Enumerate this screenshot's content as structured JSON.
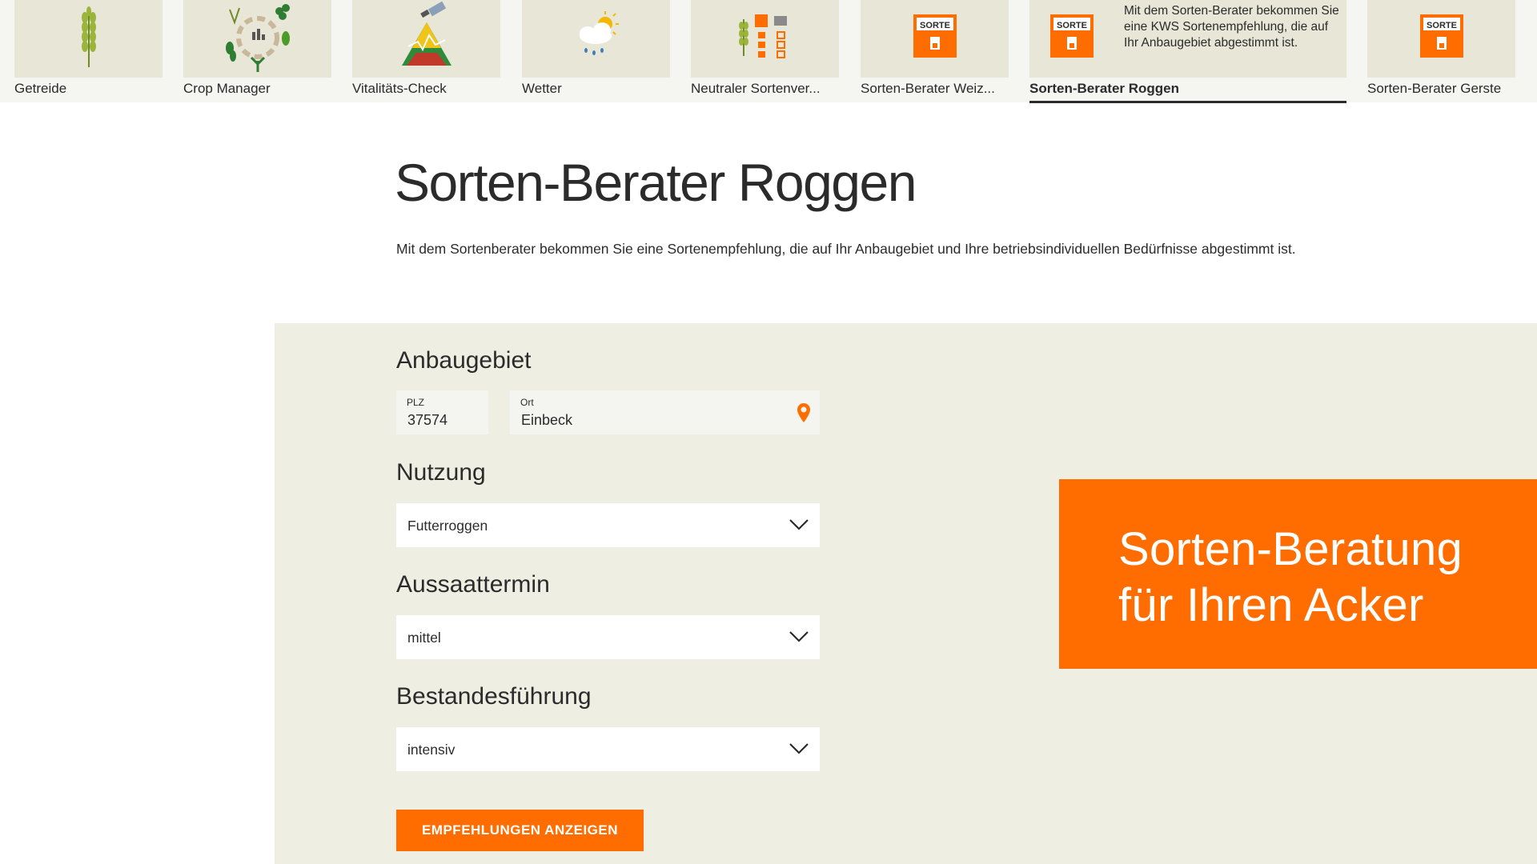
{
  "tiles": [
    {
      "label": "Getreide",
      "icon": "wheat-icon"
    },
    {
      "label": "Crop Manager",
      "icon": "crop-cycle-icon"
    },
    {
      "label": "Vitalitäts-Check",
      "icon": "satellite-field-icon"
    },
    {
      "label": "Wetter",
      "icon": "weather-icon"
    },
    {
      "label": "Neutraler Sortenver...",
      "icon": "variety-compare-icon"
    },
    {
      "label": "Sorten-Berater Weiz...",
      "icon": "sorte-icon"
    },
    {
      "label": "Sorten-Berater Roggen",
      "icon": "sorte-icon",
      "active": true,
      "description": "Mit dem Sorten-Berater bekommen Sie eine KWS Sortenempfehlung, die auf Ihr Anbaugebiet abgestimmt ist."
    },
    {
      "label": "Sorten-Berater Gerste",
      "icon": "sorte-icon"
    }
  ],
  "sorte_badge_text": "SORTE",
  "page": {
    "title": "Sorten-Berater Roggen",
    "intro": "Mit dem Sortenberater bekommen Sie eine Sortenempfehlung, die auf Ihr Anbaugebiet und Ihre betriebsindividuellen Bedürfnisse abgestimmt ist."
  },
  "form": {
    "anbaugebiet": {
      "label": "Anbaugebiet",
      "plz_label": "PLZ",
      "plz_value": "37574",
      "ort_label": "Ort",
      "ort_value": "Einbeck"
    },
    "nutzung": {
      "label": "Nutzung",
      "value": "Futterroggen"
    },
    "aussaattermin": {
      "label": "Aussaattermin",
      "value": "mittel"
    },
    "bestandesfuehrung": {
      "label": "Bestandesführung",
      "value": "intensiv"
    },
    "submit_label": "EMPFEHLUNGEN ANZEIGEN"
  },
  "promo": {
    "line1": "Sorten-Beratung",
    "line2": "für Ihren Acker"
  },
  "colors": {
    "accent": "#ff6c00",
    "panel": "#efeee3",
    "tile": "#e8e6d7"
  }
}
